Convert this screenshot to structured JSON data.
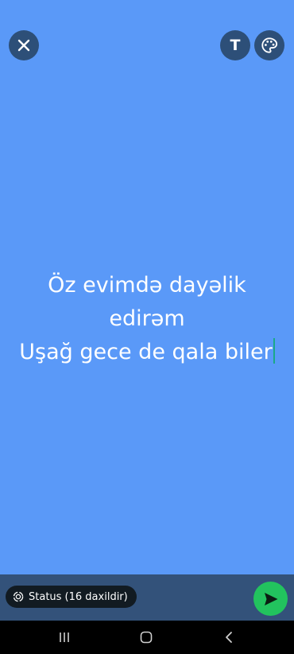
{
  "status_text": {
    "lines": [
      "Öz evimdə dayəlik",
      "edirəm",
      "Uşağ gece de qala biler"
    ]
  },
  "toolbar": {
    "text_button_label": "T"
  },
  "audience": {
    "label": "Status (16 daxildir)"
  },
  "colors": {
    "background": "#5a99f8",
    "bottom_bar": "#33527a",
    "send_button": "#22c35e",
    "caret": "#1aa889"
  },
  "icons": {
    "close": "close-icon",
    "text": "text-style-icon",
    "palette": "palette-icon",
    "audience": "status-ring-icon",
    "send": "send-icon",
    "recents": "recents-icon",
    "home": "home-icon",
    "back": "back-icon"
  }
}
